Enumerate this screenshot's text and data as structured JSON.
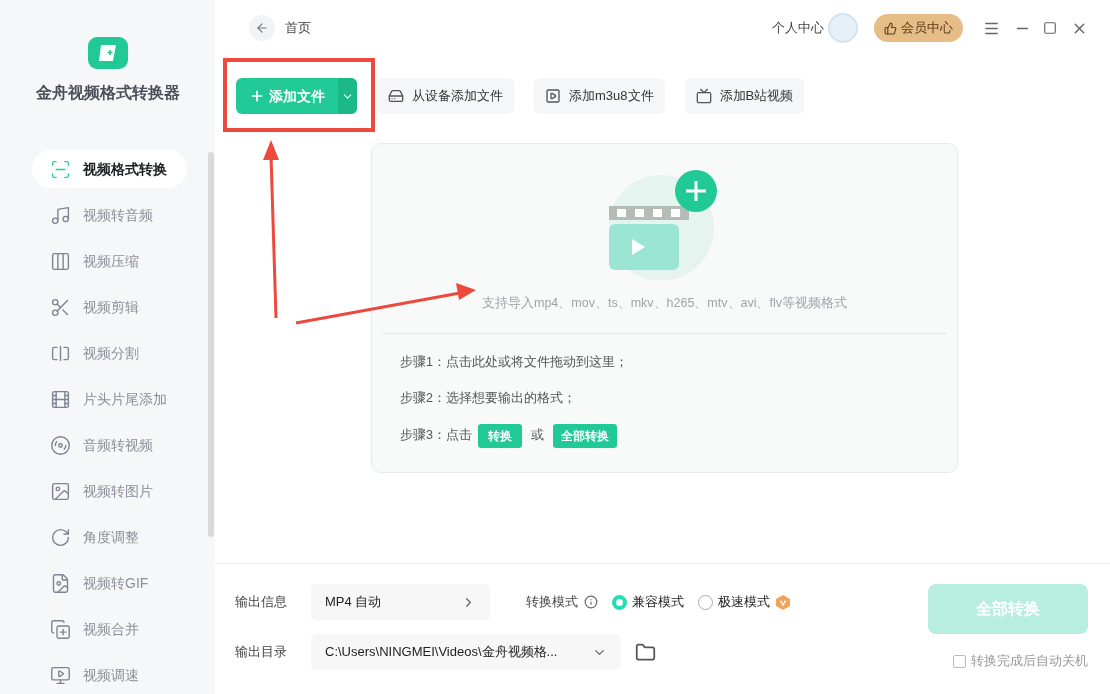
{
  "app": {
    "name": "金舟视频格式转换器"
  },
  "sidebar": {
    "items": [
      {
        "label": "视频格式转换",
        "selected": true
      },
      {
        "label": "视频转音频",
        "selected": false
      },
      {
        "label": "视频压缩",
        "selected": false
      },
      {
        "label": "视频剪辑",
        "selected": false
      },
      {
        "label": "视频分割",
        "selected": false
      },
      {
        "label": "片头片尾添加",
        "selected": false
      },
      {
        "label": "音频转视频",
        "selected": false
      },
      {
        "label": "视频转图片",
        "selected": false
      },
      {
        "label": "角度调整",
        "selected": false
      },
      {
        "label": "视频转GIF",
        "selected": false
      },
      {
        "label": "视频合并",
        "selected": false
      },
      {
        "label": "视频调速",
        "selected": false
      }
    ]
  },
  "header": {
    "breadcrumb": "首页",
    "user_center": "个人中心",
    "vip_center": "会员中心"
  },
  "toolbar": {
    "add_file": "添加文件",
    "buttons": [
      "从设备添加文件",
      "添加m3u8文件",
      "添加B站视频"
    ]
  },
  "dropzone": {
    "hint": "支持导入mp4、mov、ts、mkv、h265、mtv、avi、flv等视频格式",
    "steps": [
      {
        "kind": "text",
        "text": "步骤1：点击此处或将文件拖动到这里；"
      },
      {
        "kind": "text",
        "text": "步骤2：选择想要输出的格式；"
      },
      {
        "kind": "buttons",
        "text": "步骤3：点击",
        "button_1": "转换",
        "joiner": "或",
        "button_2": "全部转换"
      }
    ]
  },
  "output": {
    "info_label": "输出信息",
    "info_value": "MP4 自动",
    "mode_label": "转换模式",
    "modes": [
      {
        "label": "兼容模式",
        "selected": true
      },
      {
        "label": "极速模式",
        "selected": false
      }
    ],
    "dir_label": "输出目录",
    "dir_value": "C:\\Users\\NINGMEI\\Videos\\金舟视频格...",
    "convert_all": {
      "label": "全部转换",
      "disabled": true
    },
    "shutdown": {
      "label": "转换完成后自动关机",
      "checked": false
    }
  }
}
